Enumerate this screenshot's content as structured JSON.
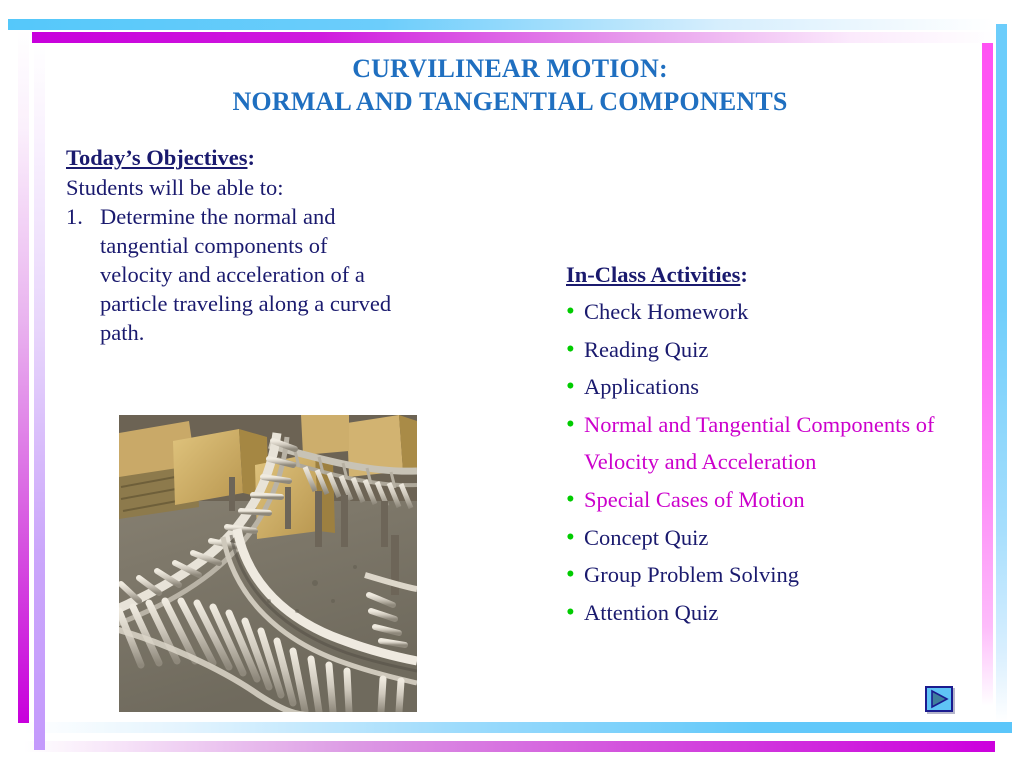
{
  "slide": {
    "title_lines": [
      "CURVILINEAR MOTION:",
      "NORMAL AND TANGENTIAL COMPONENTS"
    ],
    "title_color": "#1F6FC0"
  },
  "objectives": {
    "heading": "Today’s Objectives",
    "heading_colon": ":",
    "subheading": "Students will be able to:",
    "items": [
      {
        "number": "1.",
        "text": "Determine the normal and tangential components of velocity and acceleration of a particle traveling along a curved path."
      }
    ],
    "text_color": "#1A1A6E"
  },
  "activities": {
    "heading": "In-Class Activities",
    "heading_colon": ":",
    "bullet_glyph": "•",
    "bullet_color": "#00CC00",
    "highlight_color": "#CC00CC",
    "items": [
      {
        "label": "Check Homework",
        "highlighted": false
      },
      {
        "label": "Reading Quiz",
        "highlighted": false
      },
      {
        "label": "Applications",
        "highlighted": false
      },
      {
        "label": "Normal and Tangential Components of Velocity and Acceleration",
        "highlighted": true
      },
      {
        "label": "Special Cases of Motion",
        "highlighted": true
      },
      {
        "label": "Concept Quiz",
        "highlighted": false
      },
      {
        "label": "Group Problem Solving",
        "highlighted": false
      },
      {
        "label": "Attention Quiz",
        "highlighted": false
      }
    ]
  },
  "photo": {
    "caption": "curved roller conveyor with cardboard boxes in a warehouse"
  },
  "navigation": {
    "next_label": "▶"
  },
  "decor": {
    "cyan": "#5BC6FA",
    "magenta": "#C800DC",
    "light_purple": "#C49AFC",
    "pink": "#FF52F3"
  }
}
